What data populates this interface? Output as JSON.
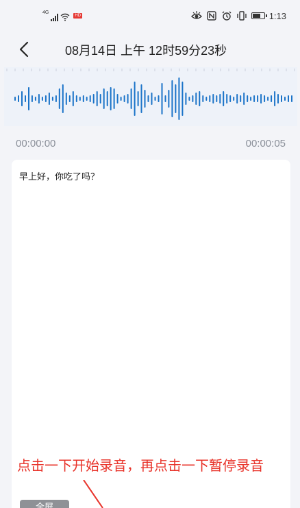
{
  "status_bar": {
    "network": "4G",
    "hd_badge": "HD",
    "time": "1:13",
    "icons": [
      "signal-icon",
      "wifi-icon",
      "eye-icon",
      "nfc-icon",
      "alarm-icon",
      "vibrate-icon",
      "battery-icon"
    ]
  },
  "header": {
    "back_icon": "chevron-left-icon",
    "title": "08月14日 上午 12时59分23秒"
  },
  "player": {
    "current_time": "00:00:00",
    "total_time": "00:00:05",
    "accent_color": "#1a73c8"
  },
  "transcript": {
    "text": "早上好，你吃了吗？"
  },
  "annotation": {
    "text": "点击一下开始录音，再点击一下暂停录音",
    "color": "#e8332a"
  },
  "bottom_button": {
    "label": "全屏"
  }
}
